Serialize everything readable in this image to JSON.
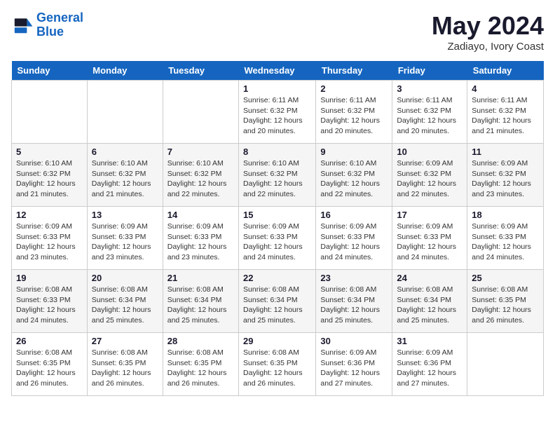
{
  "header": {
    "logo_line1": "General",
    "logo_line2": "Blue",
    "month_title": "May 2024",
    "location": "Zadiayo, Ivory Coast"
  },
  "weekdays": [
    "Sunday",
    "Monday",
    "Tuesday",
    "Wednesday",
    "Thursday",
    "Friday",
    "Saturday"
  ],
  "weeks": [
    [
      {
        "day": "",
        "sunrise": "",
        "sunset": "",
        "daylight": ""
      },
      {
        "day": "",
        "sunrise": "",
        "sunset": "",
        "daylight": ""
      },
      {
        "day": "",
        "sunrise": "",
        "sunset": "",
        "daylight": ""
      },
      {
        "day": "1",
        "sunrise": "Sunrise: 6:11 AM",
        "sunset": "Sunset: 6:32 PM",
        "daylight": "Daylight: 12 hours and 20 minutes."
      },
      {
        "day": "2",
        "sunrise": "Sunrise: 6:11 AM",
        "sunset": "Sunset: 6:32 PM",
        "daylight": "Daylight: 12 hours and 20 minutes."
      },
      {
        "day": "3",
        "sunrise": "Sunrise: 6:11 AM",
        "sunset": "Sunset: 6:32 PM",
        "daylight": "Daylight: 12 hours and 20 minutes."
      },
      {
        "day": "4",
        "sunrise": "Sunrise: 6:11 AM",
        "sunset": "Sunset: 6:32 PM",
        "daylight": "Daylight: 12 hours and 21 minutes."
      }
    ],
    [
      {
        "day": "5",
        "sunrise": "Sunrise: 6:10 AM",
        "sunset": "Sunset: 6:32 PM",
        "daylight": "Daylight: 12 hours and 21 minutes."
      },
      {
        "day": "6",
        "sunrise": "Sunrise: 6:10 AM",
        "sunset": "Sunset: 6:32 PM",
        "daylight": "Daylight: 12 hours and 21 minutes."
      },
      {
        "day": "7",
        "sunrise": "Sunrise: 6:10 AM",
        "sunset": "Sunset: 6:32 PM",
        "daylight": "Daylight: 12 hours and 22 minutes."
      },
      {
        "day": "8",
        "sunrise": "Sunrise: 6:10 AM",
        "sunset": "Sunset: 6:32 PM",
        "daylight": "Daylight: 12 hours and 22 minutes."
      },
      {
        "day": "9",
        "sunrise": "Sunrise: 6:10 AM",
        "sunset": "Sunset: 6:32 PM",
        "daylight": "Daylight: 12 hours and 22 minutes."
      },
      {
        "day": "10",
        "sunrise": "Sunrise: 6:09 AM",
        "sunset": "Sunset: 6:32 PM",
        "daylight": "Daylight: 12 hours and 22 minutes."
      },
      {
        "day": "11",
        "sunrise": "Sunrise: 6:09 AM",
        "sunset": "Sunset: 6:32 PM",
        "daylight": "Daylight: 12 hours and 23 minutes."
      }
    ],
    [
      {
        "day": "12",
        "sunrise": "Sunrise: 6:09 AM",
        "sunset": "Sunset: 6:33 PM",
        "daylight": "Daylight: 12 hours and 23 minutes."
      },
      {
        "day": "13",
        "sunrise": "Sunrise: 6:09 AM",
        "sunset": "Sunset: 6:33 PM",
        "daylight": "Daylight: 12 hours and 23 minutes."
      },
      {
        "day": "14",
        "sunrise": "Sunrise: 6:09 AM",
        "sunset": "Sunset: 6:33 PM",
        "daylight": "Daylight: 12 hours and 23 minutes."
      },
      {
        "day": "15",
        "sunrise": "Sunrise: 6:09 AM",
        "sunset": "Sunset: 6:33 PM",
        "daylight": "Daylight: 12 hours and 24 minutes."
      },
      {
        "day": "16",
        "sunrise": "Sunrise: 6:09 AM",
        "sunset": "Sunset: 6:33 PM",
        "daylight": "Daylight: 12 hours and 24 minutes."
      },
      {
        "day": "17",
        "sunrise": "Sunrise: 6:09 AM",
        "sunset": "Sunset: 6:33 PM",
        "daylight": "Daylight: 12 hours and 24 minutes."
      },
      {
        "day": "18",
        "sunrise": "Sunrise: 6:09 AM",
        "sunset": "Sunset: 6:33 PM",
        "daylight": "Daylight: 12 hours and 24 minutes."
      }
    ],
    [
      {
        "day": "19",
        "sunrise": "Sunrise: 6:08 AM",
        "sunset": "Sunset: 6:33 PM",
        "daylight": "Daylight: 12 hours and 24 minutes."
      },
      {
        "day": "20",
        "sunrise": "Sunrise: 6:08 AM",
        "sunset": "Sunset: 6:34 PM",
        "daylight": "Daylight: 12 hours and 25 minutes."
      },
      {
        "day": "21",
        "sunrise": "Sunrise: 6:08 AM",
        "sunset": "Sunset: 6:34 PM",
        "daylight": "Daylight: 12 hours and 25 minutes."
      },
      {
        "day": "22",
        "sunrise": "Sunrise: 6:08 AM",
        "sunset": "Sunset: 6:34 PM",
        "daylight": "Daylight: 12 hours and 25 minutes."
      },
      {
        "day": "23",
        "sunrise": "Sunrise: 6:08 AM",
        "sunset": "Sunset: 6:34 PM",
        "daylight": "Daylight: 12 hours and 25 minutes."
      },
      {
        "day": "24",
        "sunrise": "Sunrise: 6:08 AM",
        "sunset": "Sunset: 6:34 PM",
        "daylight": "Daylight: 12 hours and 25 minutes."
      },
      {
        "day": "25",
        "sunrise": "Sunrise: 6:08 AM",
        "sunset": "Sunset: 6:35 PM",
        "daylight": "Daylight: 12 hours and 26 minutes."
      }
    ],
    [
      {
        "day": "26",
        "sunrise": "Sunrise: 6:08 AM",
        "sunset": "Sunset: 6:35 PM",
        "daylight": "Daylight: 12 hours and 26 minutes."
      },
      {
        "day": "27",
        "sunrise": "Sunrise: 6:08 AM",
        "sunset": "Sunset: 6:35 PM",
        "daylight": "Daylight: 12 hours and 26 minutes."
      },
      {
        "day": "28",
        "sunrise": "Sunrise: 6:08 AM",
        "sunset": "Sunset: 6:35 PM",
        "daylight": "Daylight: 12 hours and 26 minutes."
      },
      {
        "day": "29",
        "sunrise": "Sunrise: 6:08 AM",
        "sunset": "Sunset: 6:35 PM",
        "daylight": "Daylight: 12 hours and 26 minutes."
      },
      {
        "day": "30",
        "sunrise": "Sunrise: 6:09 AM",
        "sunset": "Sunset: 6:36 PM",
        "daylight": "Daylight: 12 hours and 27 minutes."
      },
      {
        "day": "31",
        "sunrise": "Sunrise: 6:09 AM",
        "sunset": "Sunset: 6:36 PM",
        "daylight": "Daylight: 12 hours and 27 minutes."
      },
      {
        "day": "",
        "sunrise": "",
        "sunset": "",
        "daylight": ""
      }
    ]
  ]
}
